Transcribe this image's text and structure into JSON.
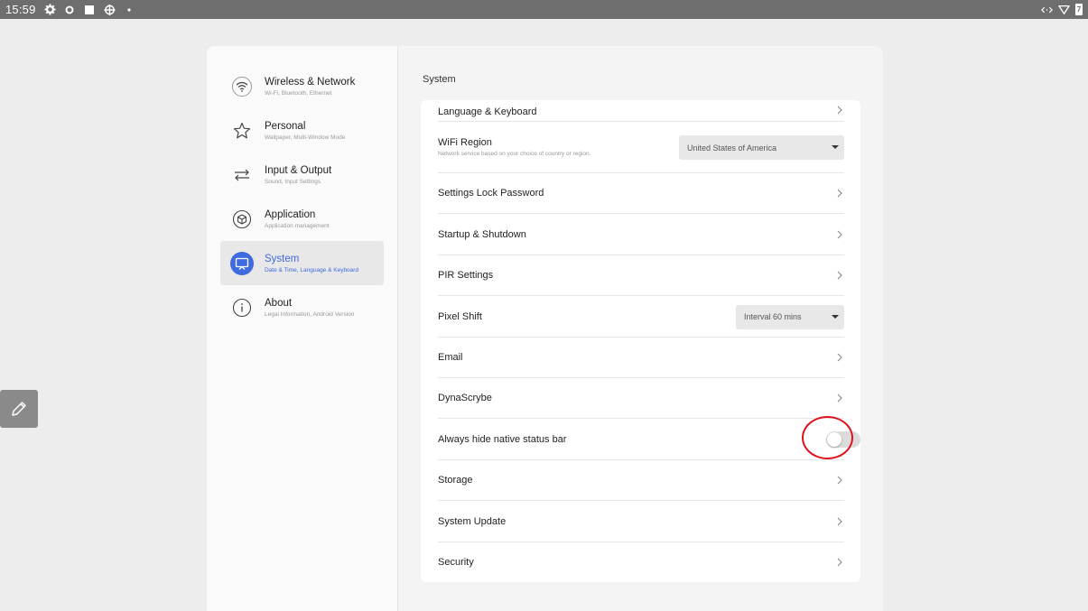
{
  "statusbar": {
    "time": "15:59",
    "battery_level": "7"
  },
  "sidebar": {
    "items": [
      {
        "title": "Wireless & Network",
        "subtitle": "Wi-Fi, Bluetooth, Ethernet",
        "icon": "wifi-icon"
      },
      {
        "title": "Personal",
        "subtitle": "Wallpaper, Multi-Window Mode",
        "icon": "star-icon"
      },
      {
        "title": "Input & Output",
        "subtitle": "Sound, Input Settings",
        "icon": "swap-arrows-icon"
      },
      {
        "title": "Application",
        "subtitle": "Application management",
        "icon": "cube-icon"
      },
      {
        "title": "System",
        "subtitle": "Date & Time, Language & Keyboard",
        "icon": "monitor-icon",
        "active": true
      },
      {
        "title": "About",
        "subtitle": "Legal Information, Android Version",
        "icon": "info-icon"
      }
    ]
  },
  "content": {
    "title": "System",
    "rows": [
      {
        "label": "Language & Keyboard",
        "type": "chevron"
      },
      {
        "label": "WiFi Region",
        "subtitle": "Network service based on your choice of country or region.",
        "type": "dropdown",
        "value": "United States of America"
      },
      {
        "label": "Settings Lock Password",
        "type": "chevron"
      },
      {
        "label": "Startup & Shutdown",
        "type": "chevron"
      },
      {
        "label": "PIR Settings",
        "type": "chevron"
      },
      {
        "label": "Pixel Shift",
        "type": "dropdown",
        "value": "Interval 60 mins"
      },
      {
        "label": "Email",
        "type": "chevron"
      },
      {
        "label": "DynaScrybe",
        "type": "chevron"
      },
      {
        "label": "Always hide native status bar",
        "type": "toggle",
        "checked": false
      },
      {
        "label": "Storage",
        "type": "chevron"
      },
      {
        "label": "System Update",
        "type": "chevron"
      },
      {
        "label": "Security",
        "type": "chevron"
      }
    ]
  },
  "colors": {
    "accent": "#3f6ae0",
    "statusbar": "#6e6e6e",
    "highlight": "#e0121b"
  }
}
